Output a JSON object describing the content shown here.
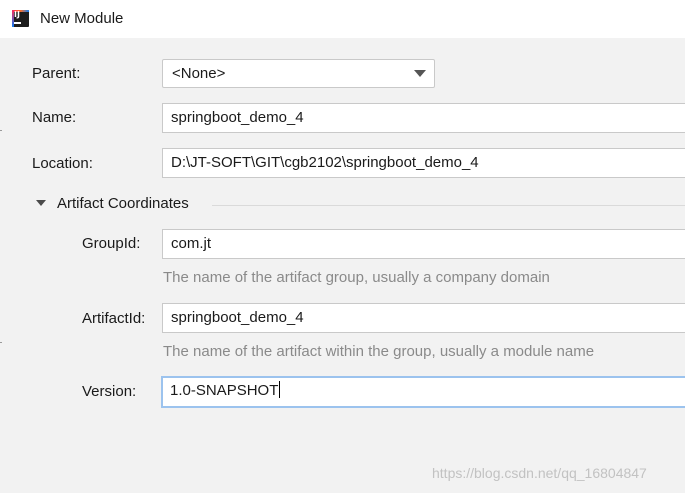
{
  "window": {
    "title": "New Module",
    "icon": "intellij-idea-icon"
  },
  "form": {
    "parent": {
      "label": "Parent:",
      "value": "<None>"
    },
    "name": {
      "label": "Name:",
      "value": "springboot_demo_4"
    },
    "location": {
      "label": "Location:",
      "value": "D:\\JT-SOFT\\GIT\\cgb2102\\springboot_demo_4"
    }
  },
  "artifact": {
    "section_label": "Artifact Coordinates",
    "group_id": {
      "label": "GroupId:",
      "value": "com.jt",
      "hint": "The name of the artifact group, usually a company domain"
    },
    "artifact_id": {
      "label": "ArtifactId:",
      "value": "springboot_demo_4",
      "hint": "The name of the artifact within the group, usually a module name"
    },
    "version": {
      "label": "Version:",
      "value": "1.0-SNAPSHOT"
    }
  },
  "watermark": "https://blog.csdn.net/qq_16804847",
  "colors": {
    "focus_border": "#9cc3ee",
    "hint_text": "#8a8a8a",
    "background": "#f2f2f2"
  }
}
